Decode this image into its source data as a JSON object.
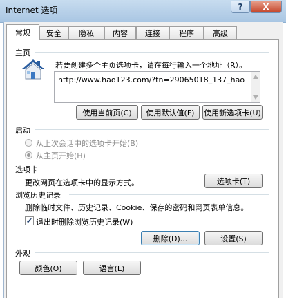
{
  "window": {
    "title": "Internet 选项",
    "help_label": "?",
    "close_label": "X"
  },
  "tabs": [
    "常规",
    "安全",
    "隐私",
    "内容",
    "连接",
    "程序",
    "高级"
  ],
  "home_page": {
    "section_title": "主页",
    "instruction": "若要创建多个主页选项卡，请在每行输入一个地址（R）。",
    "url": "http://www.hao123.com/?tn=29065018_137_hao",
    "btn_current": "使用当前页(C)",
    "btn_default": "使用默认值(F)",
    "btn_new_tab": "使用新选项卡(U)",
    "icon": "house-icon"
  },
  "startup": {
    "section_title": "启动",
    "option_last_session": "从上次会话中的选项卡开始(B)",
    "option_home": "从主页开始(H)"
  },
  "tabs_section": {
    "section_title": "选项卡",
    "description": "更改网页在选项卡中的显示方式。",
    "btn_tabs": "选项卡(T)"
  },
  "history": {
    "section_title": "浏览历史记录",
    "description": "删除临时文件、历史记录、Cookie、保存的密码和网页表单信息。",
    "checkbox_label": "退出时删除浏览历史记录(W)",
    "btn_delete": "删除(D)...",
    "btn_settings": "设置(S)"
  },
  "appearance": {
    "section_title": "外观",
    "btn_colors": "颜色(O)",
    "btn_languages": "语言(L)"
  }
}
